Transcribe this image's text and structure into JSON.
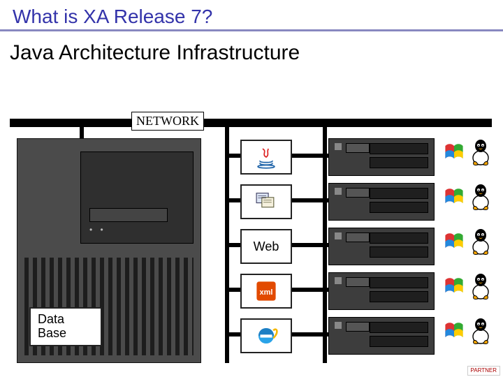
{
  "title": "What is XA Release 7?",
  "subtitle": "Java Architecture Infrastructure",
  "network_label": "NETWORK",
  "mainframe": {
    "db_label_line1": "Data",
    "db_label_line2": "Base"
  },
  "protocols": [
    {
      "id": "java",
      "label": "Java",
      "kind": "icon"
    },
    {
      "id": "host",
      "label": "Host",
      "kind": "icon"
    },
    {
      "id": "web",
      "label": "Web",
      "kind": "text"
    },
    {
      "id": "xml",
      "label": "xml",
      "kind": "icon"
    },
    {
      "id": "ie",
      "label": "Internet Explorer",
      "kind": "icon"
    }
  ],
  "server_count": 5,
  "client_os": [
    "windows",
    "linux"
  ],
  "partner_badge": "PARTNER",
  "colors": {
    "title": "#3333aa",
    "rule": "#8888c0",
    "chassis": "#4b4b4b"
  }
}
